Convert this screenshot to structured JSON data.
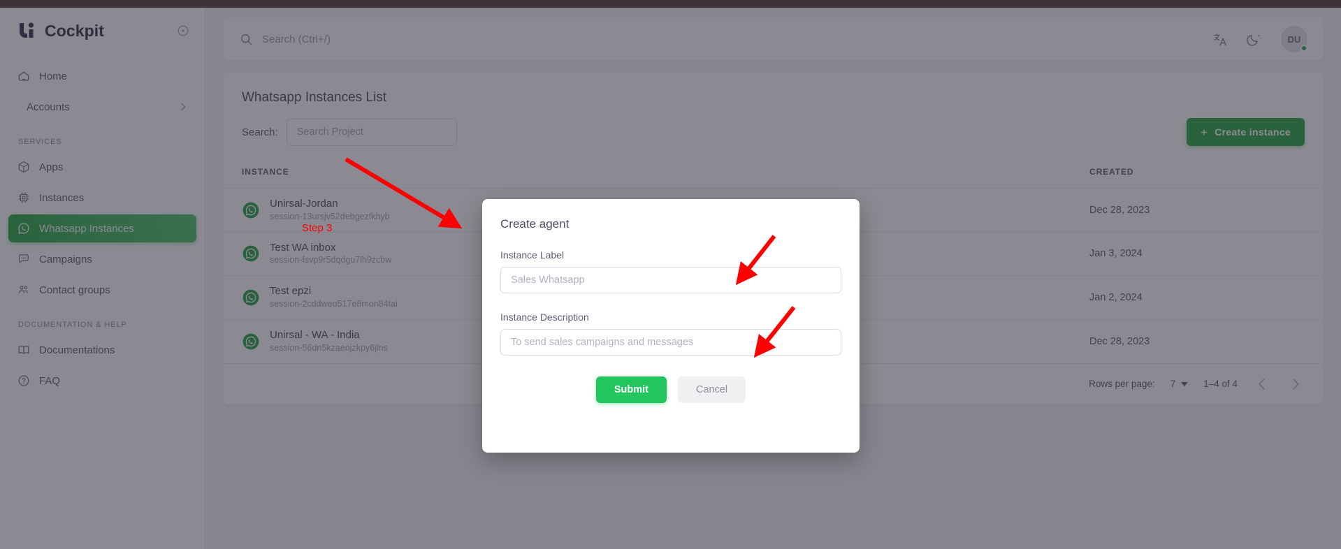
{
  "sidebar": {
    "brand": {
      "name": "Cockpit",
      "logo_icon": "cockpit-logo-icon",
      "pin_icon": "pin-circle-icon"
    },
    "items": [
      {
        "label": "Home",
        "icon": "home-icon",
        "active": false,
        "indent": false,
        "chevron": false
      },
      {
        "label": "Accounts",
        "icon": "none",
        "active": false,
        "indent": true,
        "chevron": true
      }
    ],
    "sections": [
      {
        "title": "SERVICES",
        "items": [
          {
            "label": "Apps",
            "icon": "box-icon",
            "active": false
          },
          {
            "label": "Instances",
            "icon": "cpu-icon",
            "active": false
          },
          {
            "label": "Whatsapp Instances",
            "icon": "whatsapp-icon",
            "active": true
          },
          {
            "label": "Campaigns",
            "icon": "chat-bubble-icon",
            "active": false
          },
          {
            "label": "Contact groups",
            "icon": "users-icon",
            "active": false
          }
        ]
      },
      {
        "title": "DOCUMENTATION & HELP",
        "items": [
          {
            "label": "Documentations",
            "icon": "book-icon",
            "active": false
          },
          {
            "label": "FAQ",
            "icon": "question-circle-icon",
            "active": false
          }
        ]
      }
    ]
  },
  "topbar": {
    "search_placeholder": "Search (Ctrl+/)",
    "search_value": "",
    "search_icon": "search-icon",
    "language_icon": "translate-icon",
    "theme_icon": "moon-icon",
    "avatar_initials": "DU",
    "status_color": "#28a745"
  },
  "page": {
    "title": "Whatsapp Instances List",
    "search_label": "Search:",
    "search_placeholder": "Search Project",
    "search_value": "",
    "create_button": {
      "label": "Create instance",
      "plus": "+",
      "color": "#28a745"
    }
  },
  "table": {
    "columns": [
      "INSTANCE",
      "",
      "CREATED"
    ],
    "rows": [
      {
        "name": "Unirsal-Jordan",
        "session": "session-13ursjv52debgezfkhyb",
        "created": "Dec 28, 2023",
        "icon": "whatsapp-icon"
      },
      {
        "name": "Test WA inbox",
        "session": "session-fsvp9r5dqdgu7lh9zcbw",
        "created": "Jan 3, 2024",
        "icon": "whatsapp-icon"
      },
      {
        "name": "Test epzi",
        "session": "session-2cddweo517e8mon84tai",
        "created": "Jan 2, 2024",
        "icon": "whatsapp-icon"
      },
      {
        "name": "Unirsal - WA - India",
        "session": "session-56dn5kzaeojzkpy6jlns",
        "created": "Dec 28, 2023",
        "icon": "whatsapp-icon"
      }
    ]
  },
  "pagination": {
    "rows_per_page_label": "Rows per page:",
    "rows_per_page_value": "7",
    "range_label": "1–4 of 4",
    "prev_icon": "chevron-left-icon",
    "next_icon": "chevron-right-icon"
  },
  "modal": {
    "title": "Create agent",
    "fields": [
      {
        "label": "Instance Label",
        "placeholder": "Sales Whatsapp",
        "value": ""
      },
      {
        "label": "Instance Description",
        "placeholder": "To send sales campaigns and messages",
        "value": ""
      }
    ],
    "submit_label": "Submit",
    "cancel_label": "Cancel",
    "submit_color": "#22c55e"
  },
  "annotations": {
    "step_label": "Step 3",
    "color": "#ff0000",
    "arrows": 3
  }
}
